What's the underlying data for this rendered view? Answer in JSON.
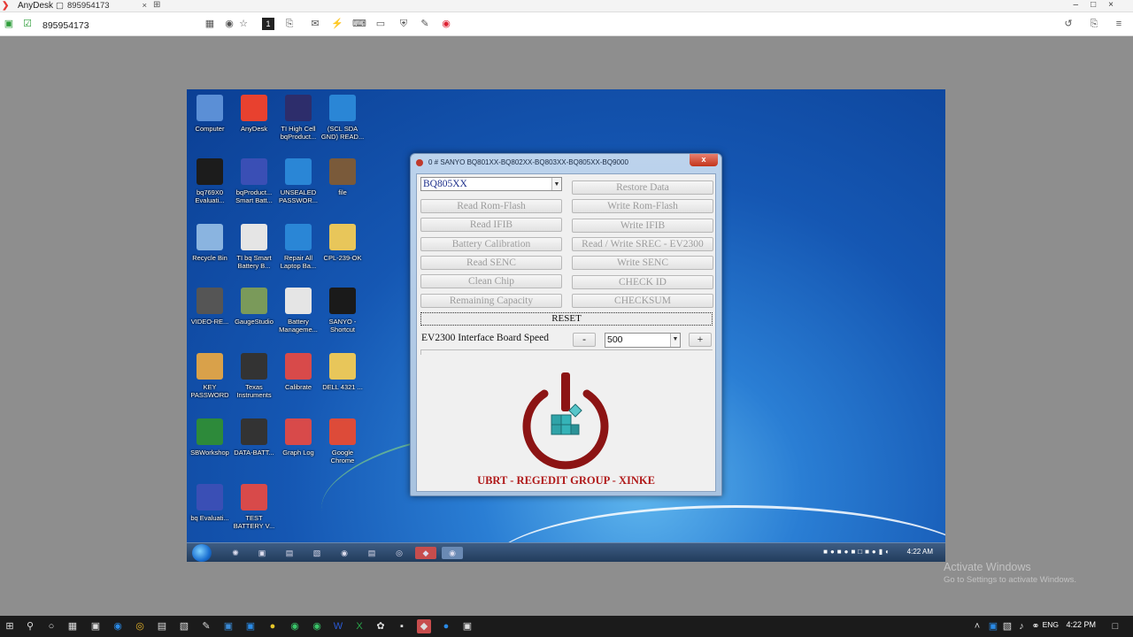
{
  "anydesk": {
    "app_name": "AnyDesk",
    "tab_label": "895954173",
    "address": "895954173"
  },
  "desktop_icons": [
    {
      "label": "Computer",
      "color": "#5b8fd6"
    },
    {
      "label": "AnyDesk",
      "color": "#e8412f"
    },
    {
      "label": "TI High Cell bqProduct...",
      "color": "#2d2d6b"
    },
    {
      "label": "(SCL SDA GND) READ...",
      "color": "#2a86d6"
    },
    {
      "label": "bq769X0 Evaluati...",
      "color": "#1c1c1c"
    },
    {
      "label": "bqProduct... Smart Batt...",
      "color": "#3a4fb5"
    },
    {
      "label": "UNSEALED PASSWOR...",
      "color": "#2a86d6"
    },
    {
      "label": "file",
      "color": "#7a5a3a"
    },
    {
      "label": "Recycle Bin",
      "color": "#8ab4e0"
    },
    {
      "label": "TI bq Smart Battery B...",
      "color": "#e5e5e5"
    },
    {
      "label": "Repair All Laptop Ba...",
      "color": "#2a86d6"
    },
    {
      "label": "CPL-239-OK",
      "color": "#e8c65a"
    },
    {
      "label": "VIDEO-RE...",
      "color": "#555555"
    },
    {
      "label": "GaugeStudio",
      "color": "#7a9a5a"
    },
    {
      "label": "Battery Manageme...",
      "color": "#e5e5e5"
    },
    {
      "label": "SANYO - Shortcut",
      "color": "#1a1a1a"
    },
    {
      "label": "KEY PASSWORD",
      "color": "#d9a14a"
    },
    {
      "label": "Texas Instruments",
      "color": "#333333"
    },
    {
      "label": "Calibrate",
      "color": "#d84a4a"
    },
    {
      "label": "DELL 4321 ...",
      "color": "#e8c65a"
    },
    {
      "label": "SBWorkshop",
      "color": "#2d8a3a"
    },
    {
      "label": "DATA-BATT...",
      "color": "#333333"
    },
    {
      "label": "Graph Log",
      "color": "#d84a4a"
    },
    {
      "label": "Google Chrome",
      "color": "#dd4b39"
    },
    {
      "label": "bq Evaluati...",
      "color": "#3a4fb5"
    },
    {
      "label": "TEST BATTERY V...",
      "color": "#d84a4a"
    }
  ],
  "tool_window": {
    "title": "0 # SANYO BQ801XX-BQ802XX-BQ803XX-BQ805XX-BQ9000",
    "close_label": "x",
    "chip_select": "BQ805XX",
    "buttons_left": [
      "Read Rom-Flash",
      "Read IFIB",
      "Battery Calibration",
      "Read SENC",
      "Clean Chip",
      "Remaining Capacity"
    ],
    "buttons_right": [
      "Restore Data",
      "Write Rom-Flash",
      "Write IFIB",
      "Read / Write SREC - EV2300",
      "Write SENC",
      "CHECK ID",
      "CHECKSUM"
    ],
    "reset_label": "RESET",
    "speed_label": "EV2300 Interface Board Speed",
    "minus_label": "-",
    "plus_label": "+",
    "speed_value": "500",
    "brand_text": "UBRT - REGEDIT GROUP - XINKE",
    "brand_color": "#b01a1a"
  },
  "remote_taskbar": {
    "time": "4:22 AM"
  },
  "activation": {
    "line1": "Activate Windows",
    "line2": "Go to Settings to activate Windows."
  },
  "local_taskbar": {
    "language": "ENG",
    "time": "4:22 PM"
  }
}
